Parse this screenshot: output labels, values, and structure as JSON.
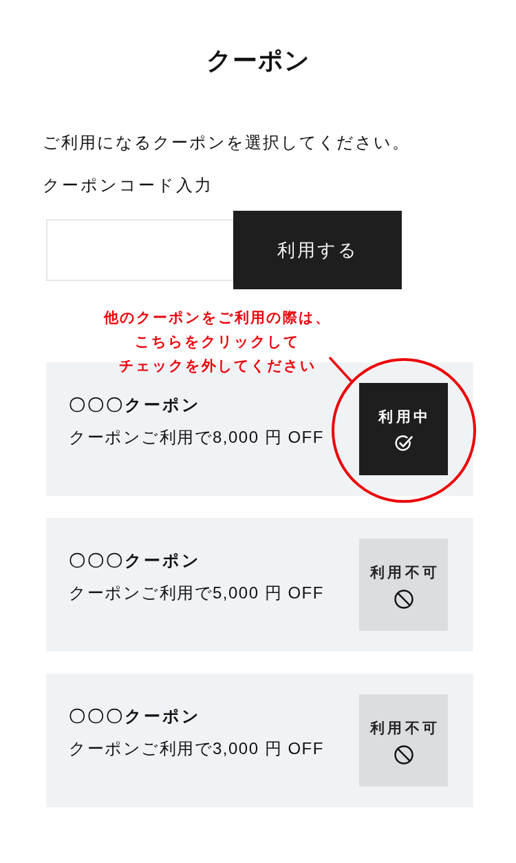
{
  "title": "クーポン",
  "instruction": "ご利用になるクーポンを選択してください。",
  "code_entry": {
    "label": "クーポンコード入力",
    "apply_button": "利用する"
  },
  "annotation": {
    "lines": [
      "他のクーポンをご利用の際は、",
      "こちらをクリックして",
      "チェックを外してください"
    ]
  },
  "coupons": [
    {
      "title": "〇〇〇クーポン",
      "description": "クーポンご利用で8,000 円 OFF",
      "status_label": "利用中",
      "kind": "in_use"
    },
    {
      "title": "〇〇〇クーポン",
      "description": "クーポンご利用で5,000 円 OFF",
      "status_label": "利用不可",
      "kind": "unavailable"
    },
    {
      "title": "〇〇〇クーポン",
      "description": "クーポンご利用で3,000 円 OFF",
      "status_label": "利用不可",
      "kind": "unavailable"
    }
  ]
}
